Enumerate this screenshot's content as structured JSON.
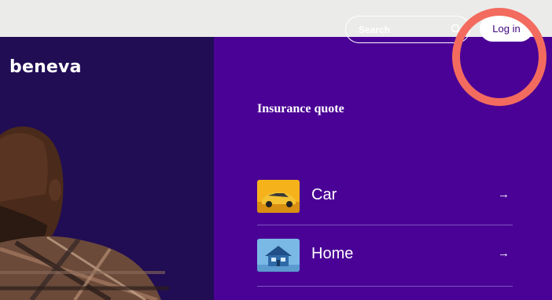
{
  "header": {
    "logo": "beneva",
    "search_label": "Search",
    "login_label": "Log in"
  },
  "insurance": {
    "title": "Insurance quote",
    "items": [
      {
        "label": "Car",
        "arrow": "→"
      },
      {
        "label": "Home",
        "arrow": "→"
      }
    ]
  },
  "colors": {
    "background": "#ebebea",
    "left_panel": "#200d54",
    "right_panel": "#4a0196",
    "highlight_circle": "#f26b5e",
    "login_text": "#3d067d"
  },
  "icons": [
    "search-icon",
    "arrow-right-icon",
    "car-thumbnail",
    "home-thumbnail"
  ]
}
